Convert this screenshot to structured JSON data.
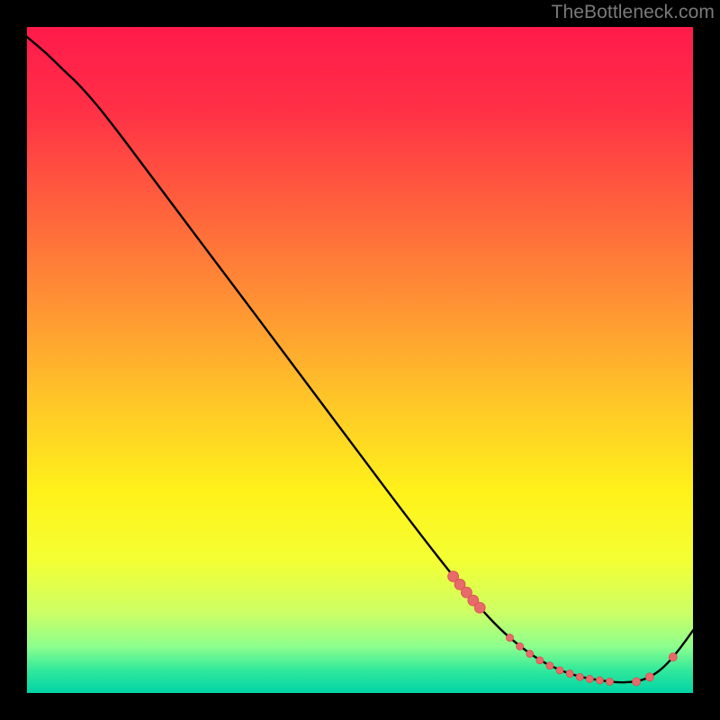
{
  "attribution": "TheBottleneck.com",
  "chart_data": {
    "type": "line",
    "title": "",
    "xlabel": "",
    "ylabel": "",
    "xlim": [
      0,
      100
    ],
    "ylim": [
      0,
      100
    ],
    "background_gradient": {
      "stops": [
        {
          "offset": 0.0,
          "color": "#ff1a4b"
        },
        {
          "offset": 0.12,
          "color": "#ff2f46"
        },
        {
          "offset": 0.25,
          "color": "#ff5a3e"
        },
        {
          "offset": 0.4,
          "color": "#ff8d35"
        },
        {
          "offset": 0.55,
          "color": "#ffc229"
        },
        {
          "offset": 0.7,
          "color": "#fff21a"
        },
        {
          "offset": 0.8,
          "color": "#f4ff33"
        },
        {
          "offset": 0.88,
          "color": "#ccff66"
        },
        {
          "offset": 0.93,
          "color": "#8dff8d"
        },
        {
          "offset": 0.965,
          "color": "#33e99b"
        },
        {
          "offset": 1.0,
          "color": "#00d4a6"
        }
      ]
    },
    "series": [
      {
        "name": "bottleneck-curve",
        "color": "#000000",
        "x": [
          0.0,
          3.0,
          5.5,
          8.0,
          12.0,
          20.0,
          30.0,
          40.0,
          50.0,
          58.0,
          64.0,
          68.0,
          71.0,
          74.0,
          77.0,
          80.0,
          83.0,
          86.0,
          88.5,
          90.0,
          92.0,
          94.0,
          96.0,
          98.0,
          100.0
        ],
        "y": [
          98.5,
          96.0,
          93.5,
          91.2,
          86.5,
          75.8,
          62.5,
          49.2,
          35.8,
          25.2,
          17.5,
          12.8,
          9.6,
          7.0,
          4.9,
          3.4,
          2.4,
          1.9,
          1.6,
          1.6,
          1.8,
          2.6,
          4.2,
          6.6,
          9.4
        ]
      }
    ],
    "markers": {
      "color": "#e96a6a",
      "stroke": "#d84f4f",
      "points": [
        {
          "x": 64.0,
          "y": 17.5,
          "r": 6.0
        },
        {
          "x": 65.0,
          "y": 16.3,
          "r": 6.0
        },
        {
          "x": 66.0,
          "y": 15.1,
          "r": 6.0
        },
        {
          "x": 67.0,
          "y": 13.9,
          "r": 6.0
        },
        {
          "x": 68.0,
          "y": 12.8,
          "r": 6.0
        },
        {
          "x": 72.5,
          "y": 8.3,
          "r": 4.0
        },
        {
          "x": 74.0,
          "y": 7.0,
          "r": 4.0
        },
        {
          "x": 75.5,
          "y": 5.9,
          "r": 4.0
        },
        {
          "x": 77.0,
          "y": 4.9,
          "r": 4.0
        },
        {
          "x": 78.5,
          "y": 4.1,
          "r": 4.0
        },
        {
          "x": 80.0,
          "y": 3.4,
          "r": 4.0
        },
        {
          "x": 81.5,
          "y": 2.9,
          "r": 4.0
        },
        {
          "x": 83.0,
          "y": 2.4,
          "r": 4.0
        },
        {
          "x": 84.5,
          "y": 2.1,
          "r": 4.0
        },
        {
          "x": 86.0,
          "y": 1.9,
          "r": 4.0
        },
        {
          "x": 87.5,
          "y": 1.7,
          "r": 4.0
        },
        {
          "x": 91.5,
          "y": 1.7,
          "r": 4.5
        },
        {
          "x": 93.5,
          "y": 2.4,
          "r": 4.5
        },
        {
          "x": 97.0,
          "y": 5.4,
          "r": 4.5
        }
      ]
    }
  }
}
